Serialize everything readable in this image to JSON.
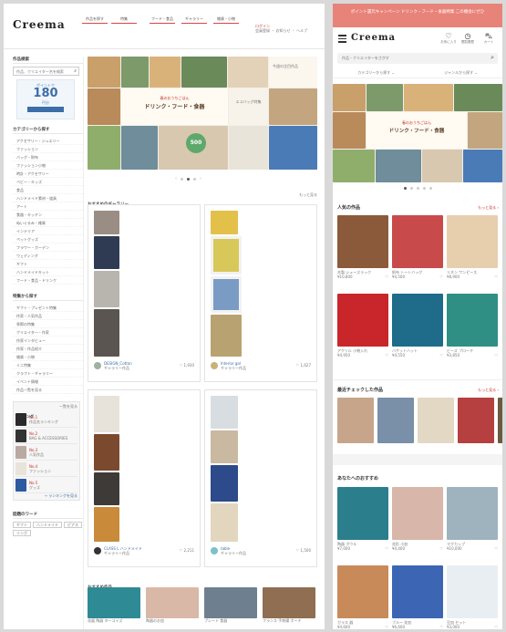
{
  "desktop": {
    "logo": "Creema",
    "nav": [
      "作品を探す",
      "特集",
      "フード・食品",
      "ギャラリー",
      "雑貨・小物"
    ],
    "header_right": {
      "line1": "ログイン",
      "line2": "会員登録 ・ お知らせ ・ ヘルプ"
    },
    "sidebar": {
      "search_label": "作品検索",
      "search_placeholder": "作品、クリエイター名を検索",
      "promo": {
        "line1": "ポイントで",
        "big": "180",
        "line2": "円分"
      },
      "categories_title": "カテゴリーから探す",
      "categories": [
        "アクセサリー・ジュエリー",
        "ファッション",
        "バッグ・財布",
        "ファッション小物",
        "時計・アクセサリー",
        "ベビー・キッズ",
        "食品",
        "ハンドメイド素材・道具",
        "アート",
        "食器・キッチン",
        "ぬいぐるみ・雑貨",
        "インテリア",
        "ペットグッズ",
        "フラワー・ガーデン",
        "ウェディング",
        "ギフト",
        "ハンドメイドキット",
        "フード・食品・ドリンク"
      ],
      "events_title": "特集から探す",
      "events": [
        "ギフト・プレゼント特集",
        "作家・人気作品",
        "季節の特集",
        "クリエイター・作家",
        "作家インタビュー",
        "作家・作品紹介",
        "雑貨・小物",
        "ミニ特集",
        "クラフト・ギャラリー",
        "イベント情報",
        "作品一覧を見る"
      ],
      "ranking_title": "ランキング",
      "ranking_more": "一覧を見る",
      "ranking": [
        {
          "rank": "No.1",
          "name": "作品名ランキング"
        },
        {
          "rank": "No.2",
          "name": "BAG & ACCESSORIES"
        },
        {
          "rank": "No.3",
          "name": "人気作品"
        },
        {
          "rank": "No.4",
          "name": "ファッション"
        },
        {
          "rank": "No.5",
          "name": "グッズ"
        }
      ],
      "ranking_link": "→ ランキングを見る",
      "keyword_title": "話題のワード",
      "keywords": [
        "ギフト",
        "ハンドメイド",
        "ピアス",
        "リング"
      ]
    },
    "hero": {
      "tag": "春のおうちごはん",
      "title": "ドリンク・フード・食器",
      "badge": "500",
      "side_text1": "今週の注目作品",
      "side_text2": "エコバッグ特集"
    },
    "gallery_title": "おすすめのギャラリー",
    "gallery_more": "もっと見る",
    "gallery_cards": [
      {
        "name": "DESIGN_Cotton",
        "meta": "ギャラリー作品",
        "count": "1,930"
      },
      {
        "name": "Interior gal",
        "meta": "ギャラリー作品",
        "count": "1,627"
      },
      {
        "name": "CLASS L ハンドメイド",
        "meta": "ギャラリー作品",
        "count": "2,211"
      },
      {
        "name": "table",
        "meta": "ギャラリー作品",
        "count": "1,500"
      }
    ],
    "bottom_title": "おすすめ作品",
    "bottom_items": [
      "花器 陶器 ターコイズ",
      "陶器のお皿",
      "プレート 食器",
      "フランス 手刺繍 ポーチ"
    ]
  },
  "mobile": {
    "banner": "ポイント還元キャンペーン ドリンク・フード・食器特集 この機会にぜひ",
    "logo": "Creema",
    "header_icons": [
      {
        "label": "お気に入り"
      },
      {
        "label": "閲覧履歴"
      },
      {
        "label": "カート"
      }
    ],
    "search_placeholder": "作品・クリエイターをさがす",
    "filters": [
      "カテゴリーから探す",
      "ジャンルから探す"
    ],
    "hero_tag": "春のおうちごはん",
    "hero_title": "ドリンク・フード・食器",
    "popular_title": "人気の作品",
    "popular_more": "もっと見る ›",
    "popular": [
      {
        "title": "木製 シューズラック",
        "price": "¥10,800"
      },
      {
        "title": "帆布 トートバッグ",
        "price": "¥4,500"
      },
      {
        "title": "リネン ワンピース",
        "price": "¥8,900"
      },
      {
        "title": "アクリル 小物入れ",
        "price": "¥4,950"
      },
      {
        "title": "バケットハット",
        "price": "¥4,550"
      },
      {
        "title": "ビーズ ブローチ",
        "price": "¥3,850"
      }
    ],
    "recent_title": "最近チェックした作品",
    "recent_more": "もっと見る ›",
    "recommend_title": "あなたへのおすすめ",
    "recommend": [
      {
        "title": "陶器 ボウル",
        "price": "¥7,000"
      },
      {
        "title": "花形 小皿",
        "price": "¥4,400"
      },
      {
        "title": "マグカップ",
        "price": "¥10,000"
      },
      {
        "title": "ガラス 器",
        "price": "¥4,600"
      },
      {
        "title": "ブルー 花皿",
        "price": "¥6,600"
      },
      {
        "title": "豆皿 セット",
        "price": "¥3,000"
      }
    ]
  }
}
